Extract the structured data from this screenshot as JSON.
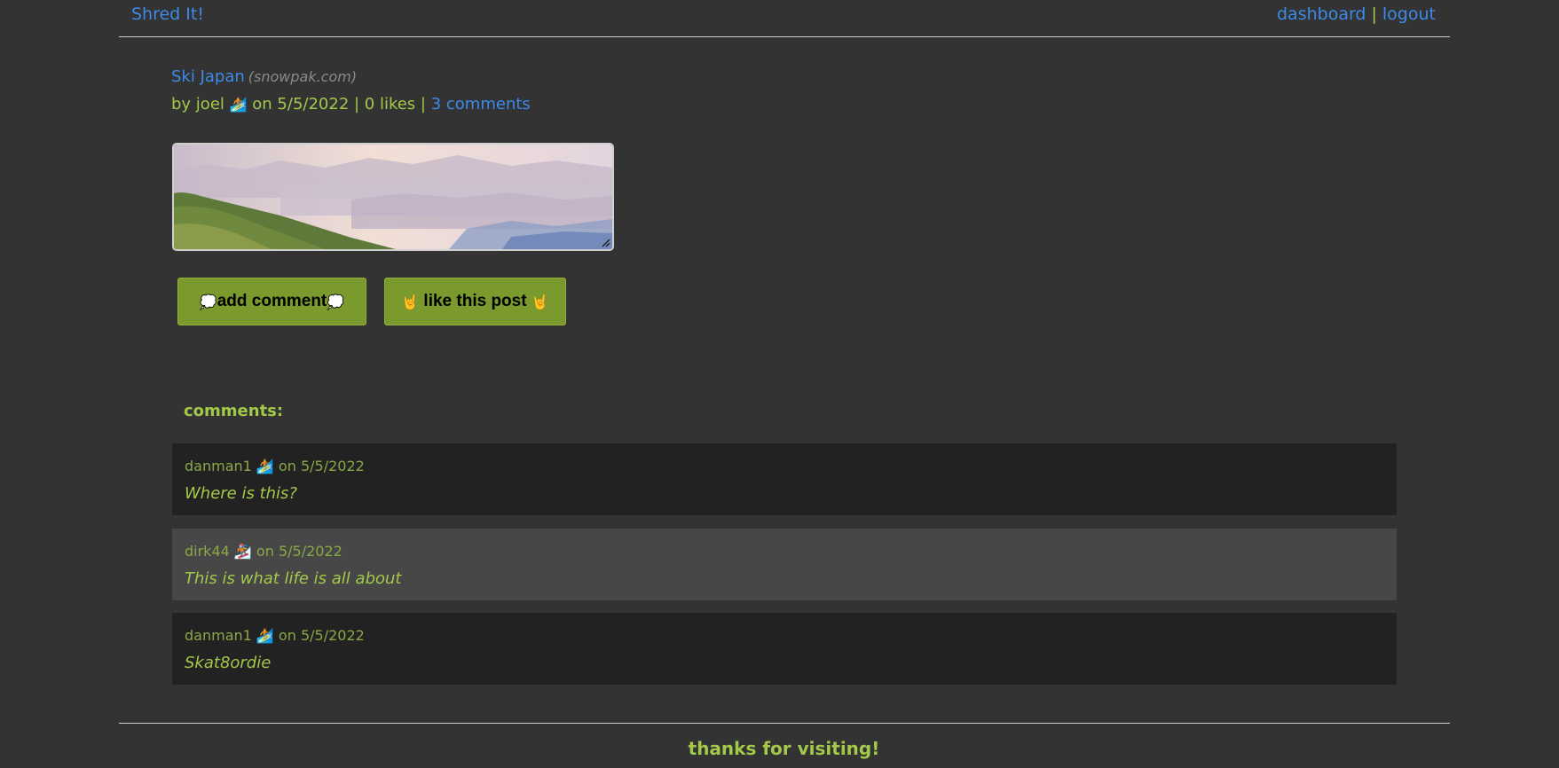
{
  "nav": {
    "brand": "Shred It!",
    "dashboard": "dashboard",
    "separator": "|",
    "logout": "logout"
  },
  "post": {
    "title": "Ski Japan",
    "source": "(snowpak.com)",
    "meta_by": "by joel",
    "author_emoji": "🏄",
    "meta_rest": "on 5/5/2022 | 0 likes |",
    "comments_link": "3 comments",
    "image_alt": "misty mountain landscape"
  },
  "buttons": {
    "add_comment": "add comment",
    "add_comment_emoji": "💭",
    "like": "like this post",
    "like_emoji": "🤘"
  },
  "comments": {
    "heading": "comments:",
    "items": [
      {
        "user": "danman1",
        "emoji": "🏄",
        "date": "on 5/5/2022",
        "text": "Where is this?"
      },
      {
        "user": "dirk44",
        "emoji": "🏂",
        "date": "on 5/5/2022",
        "text": "This is what life is all about"
      },
      {
        "user": "danman1",
        "emoji": "🏄",
        "date": "on 5/5/2022",
        "text": "Skat8ordie"
      }
    ]
  },
  "footer": {
    "text": "thanks for visiting!"
  },
  "colors": {
    "background": "#333333",
    "link": "#3d8ae8",
    "accent_green": "#a3c94a",
    "button_green": "#7a9a2e"
  }
}
